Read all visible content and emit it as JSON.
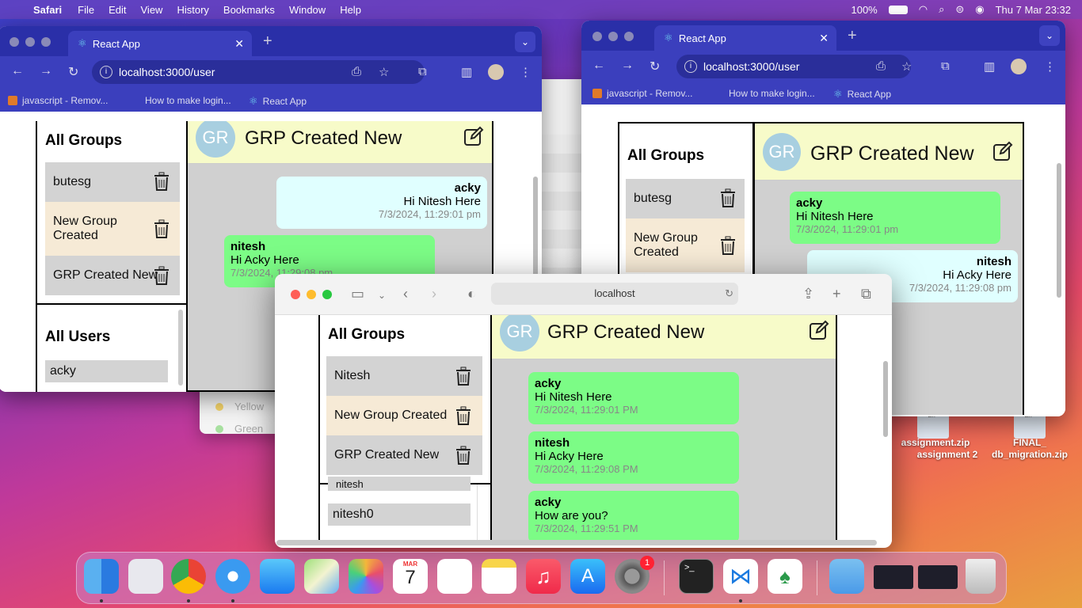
{
  "menubar": {
    "app": "Safari",
    "items": [
      "File",
      "Edit",
      "View",
      "History",
      "Bookmarks",
      "Window",
      "Help"
    ],
    "battery": "100%",
    "clock": "Thu 7 Mar  23:32"
  },
  "chrome1": {
    "tab_title": "React App",
    "url": "localhost:3000/user",
    "bookmarks": [
      "javascript - Remov...",
      "How to make login...",
      "React App"
    ],
    "groups_title": "All Groups",
    "groups": [
      "butesg",
      "New Group\nCreated",
      "GRP Created New"
    ],
    "users_title": "All Users",
    "users": [
      "acky"
    ],
    "avatar": "GR",
    "chat_title": "GRP Created New",
    "messages": [
      {
        "user": "acky",
        "text": "Hi Nitesh Here",
        "time": "7/3/2024, 11:29:01 pm"
      },
      {
        "user": "nitesh",
        "text": "Hi Acky Here",
        "time": "7/3/2024, 11:29:08 pm"
      }
    ]
  },
  "chrome2": {
    "tab_title": "React App",
    "url": "localhost:3000/user",
    "bookmarks": [
      "javascript - Remov...",
      "How to make login...",
      "React App"
    ],
    "groups_title": "All Groups",
    "groups": [
      "butesg",
      "New Group\nCreated"
    ],
    "avatar": "GR",
    "chat_title": "GRP Created New",
    "messages": [
      {
        "user": "acky",
        "text": "Hi Nitesh Here",
        "time": "7/3/2024, 11:29:01 pm"
      },
      {
        "user": "nitesh",
        "text": "Hi Acky Here",
        "time": "7/3/2024, 11:29:08 pm"
      }
    ]
  },
  "bg_window": {
    "labels": [
      "Yellow",
      "Green"
    ]
  },
  "safari": {
    "address": "localhost",
    "groups_title": "All Groups",
    "groups": [
      "Nitesh",
      "New Group Created",
      "GRP Created New"
    ],
    "users": [
      "nitesh",
      "nitesh0"
    ],
    "avatar": "GR",
    "chat_title": "GRP Created New",
    "messages": [
      {
        "user": "acky",
        "text": "Hi Nitesh Here",
        "time": "7/3/2024, 11:29:01 PM"
      },
      {
        "user": "nitesh",
        "text": "Hi Acky Here",
        "time": "7/3/2024, 11:29:08 PM"
      },
      {
        "user": "acky",
        "text": "How are you?",
        "time": "7/3/2024, 11:29:51 PM"
      }
    ]
  },
  "desktop_files": [
    {
      "name": "assignment.zip",
      "sub": "assignment 2"
    },
    {
      "name": "FINAL_",
      "sub": "db_migration.zip"
    }
  ],
  "dock": {
    "calendar_month": "MAR",
    "calendar_day": "7",
    "settings_badge": "1"
  }
}
